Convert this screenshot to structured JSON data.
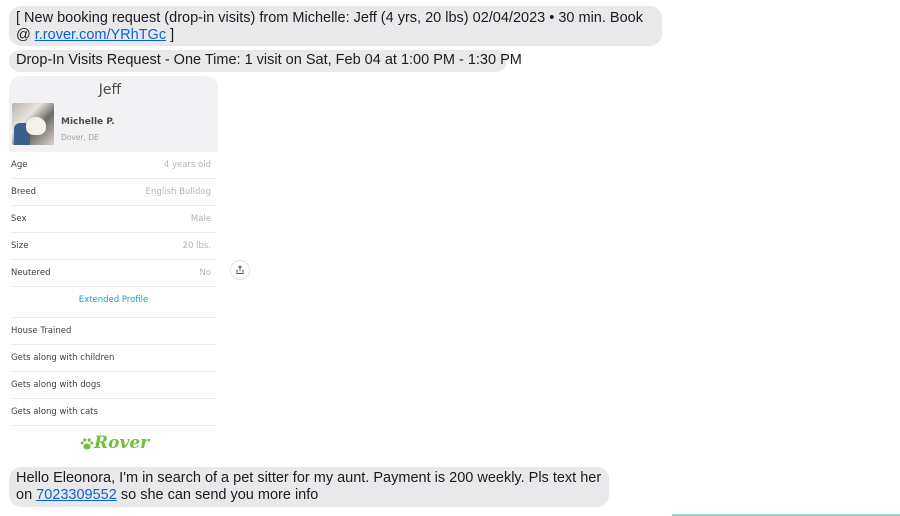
{
  "messages": {
    "booking_request_text": "[ New booking request (drop-in visits) from Michelle: Jeff (4 yrs, 20 lbs) 02/04/2023 • 30 min. Book @ ",
    "booking_link": "r.rover.com/YRhTGc",
    "booking_close": " ]",
    "visit_request": "Drop-In Visits Request - One Time: 1 visit on Sat, Feb 04 at 1:00 PM - 1:30 PM",
    "followup_text_before": "Hello Eleonora, I'm in search of a pet sitter for my aunt. Payment is 200 weekly. Pls text her on ",
    "followup_phone": "7023309552",
    "followup_text_after": " so she can send you more info"
  },
  "pet_card": {
    "pet_name": "Jeff",
    "owner_name": "Michelle P.",
    "owner_location": "Dover, DE",
    "details": [
      {
        "label": "Age",
        "value": "4 years old"
      },
      {
        "label": "Breed",
        "value": "English Bulldog"
      },
      {
        "label": "Sex",
        "value": "Male"
      },
      {
        "label": "Size",
        "value": "20 lbs."
      },
      {
        "label": "Neutered",
        "value": "No"
      }
    ],
    "extended_profile_label": "Extended Profile",
    "traits": [
      "House Trained",
      "Gets along with children",
      "Gets along with dogs",
      "Gets along with cats"
    ],
    "brand": "Rover",
    "brand_color": "#71c03c"
  },
  "icons": {
    "share": "share-icon",
    "paw": "paw-icon"
  },
  "colors": {
    "bubble_bg": "#e9e9eb",
    "link": "#0b63d6",
    "extended_profile": "#1a9fbf"
  }
}
